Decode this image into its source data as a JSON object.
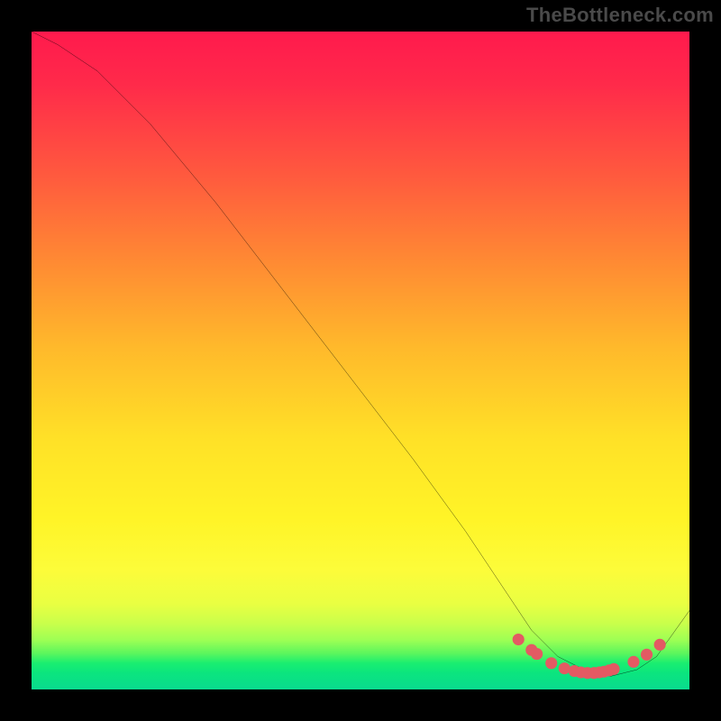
{
  "watermark": "TheBottleneck.com",
  "chart_data": {
    "type": "line",
    "title": "",
    "xlabel": "",
    "ylabel": "",
    "xlim": [
      0,
      100
    ],
    "ylim": [
      0,
      100
    ],
    "series": [
      {
        "name": "curve",
        "x": [
          0,
          4,
          10,
          18,
          28,
          38,
          48,
          58,
          66,
          72,
          76,
          80,
          84,
          88,
          92,
          95,
          100
        ],
        "y": [
          100,
          98,
          94,
          86,
          74,
          61,
          48,
          35,
          24,
          15,
          9,
          5,
          3,
          2,
          3,
          5,
          12
        ]
      }
    ],
    "markers": {
      "name": "dots",
      "x": [
        74,
        76,
        76.8,
        79,
        81,
        82.5,
        83.5,
        84.5,
        85.5,
        86.3,
        87,
        87.8,
        88.5,
        91.5,
        93.5,
        95.5
      ],
      "y": [
        7.6,
        6.0,
        5.4,
        4.0,
        3.2,
        2.8,
        2.6,
        2.5,
        2.5,
        2.6,
        2.7,
        2.9,
        3.1,
        4.2,
        5.3,
        6.8
      ]
    },
    "gradient_stops": [
      {
        "pos": 0.0,
        "color": "#ff1a4d"
      },
      {
        "pos": 0.08,
        "color": "#ff2a4a"
      },
      {
        "pos": 0.22,
        "color": "#ff5a3e"
      },
      {
        "pos": 0.35,
        "color": "#ff8a33"
      },
      {
        "pos": 0.48,
        "color": "#ffb92b"
      },
      {
        "pos": 0.62,
        "color": "#ffe127"
      },
      {
        "pos": 0.74,
        "color": "#fff427"
      },
      {
        "pos": 0.82,
        "color": "#fcfc3a"
      },
      {
        "pos": 0.87,
        "color": "#e9ff42"
      },
      {
        "pos": 0.9,
        "color": "#c9ff4b"
      },
      {
        "pos": 0.925,
        "color": "#9dff54"
      },
      {
        "pos": 0.945,
        "color": "#5cf65d"
      },
      {
        "pos": 0.96,
        "color": "#1aee70"
      },
      {
        "pos": 0.975,
        "color": "#0be57e"
      },
      {
        "pos": 0.99,
        "color": "#0adf88"
      },
      {
        "pos": 1.0,
        "color": "#0adb8f"
      }
    ],
    "marker_color": "#e35a63",
    "line_color": "#000000"
  }
}
